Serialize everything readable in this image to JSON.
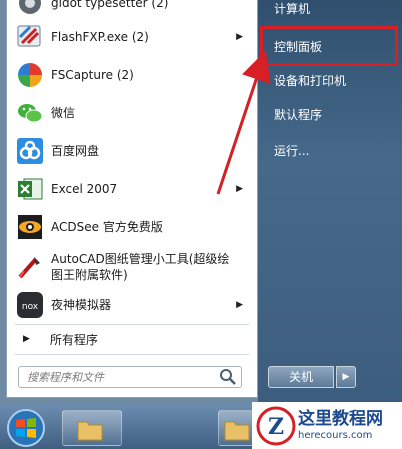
{
  "programs": [
    {
      "label": "gidot typesetter (2)",
      "icon": "gear-icon"
    },
    {
      "label": "FlashFXP.exe (2)",
      "icon": "flashfxp-icon",
      "has_submenu": true
    },
    {
      "label": "FSCapture (2)",
      "icon": "fscapture-icon"
    },
    {
      "label": "微信",
      "icon": "wechat-icon"
    },
    {
      "label": "百度网盘",
      "icon": "baidu-netdisk-icon"
    },
    {
      "label": "Excel 2007",
      "icon": "excel-icon",
      "has_submenu": true
    },
    {
      "label": "ACDSee 官方免费版",
      "icon": "acdsee-icon"
    },
    {
      "label": "AutoCAD图纸管理小工具(超级绘图王附属软件)",
      "line1": "AutoCAD图纸管理小工具(超级绘",
      "line2": "图王附属软件)",
      "icon": "autocad-icon"
    },
    {
      "label": "夜神模拟器",
      "icon": "nox-icon",
      "has_submenu": true
    }
  ],
  "all_programs": "所有程序",
  "search": {
    "placeholder": "搜索程序和文件"
  },
  "right_items": [
    "计算机",
    "控制面板",
    "设备和打印机",
    "默认程序",
    "运行..."
  ],
  "shutdown": {
    "label": "关机"
  },
  "highlight_color": "#d71f25",
  "watermark": {
    "title": "这里教程网",
    "url": "herecours.com"
  }
}
